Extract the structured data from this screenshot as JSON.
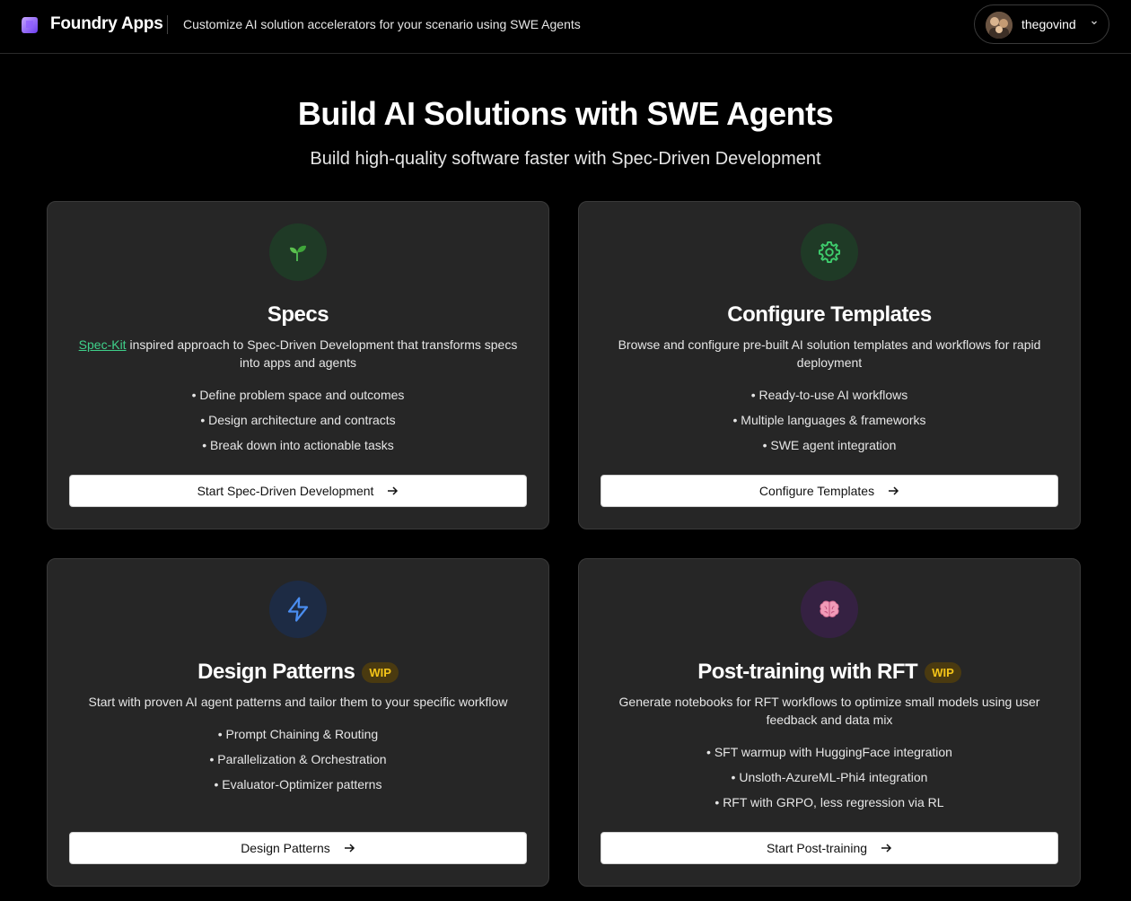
{
  "header": {
    "app_title": "Foundry Apps",
    "tagline": "Customize AI solution accelerators for your scenario using SWE Agents",
    "username": "thegovind",
    "logo_icon": "foundry-logo-icon",
    "chevron_icon": "chevron-down-icon"
  },
  "hero": {
    "title": "Build AI Solutions with SWE Agents",
    "subtitle": "Build high-quality software faster with Spec-Driven Development"
  },
  "cards": [
    {
      "icon": "seedling-icon",
      "title": "Specs",
      "link_text": "Spec-Kit",
      "description": " inspired approach to Spec-Driven Development that transforms specs into apps and agents",
      "bullets": [
        "• Define problem space and outcomes",
        "• Design architecture and contracts",
        "• Break down into actionable tasks"
      ],
      "button": "Start Spec-Driven Development"
    },
    {
      "icon": "gear-icon",
      "title": "Configure Templates",
      "description": "Browse and configure pre-built AI solution templates and workflows for rapid deployment",
      "bullets": [
        "• Ready-to-use AI workflows",
        "• Multiple languages & frameworks",
        "• SWE agent integration"
      ],
      "button": "Configure Templates"
    },
    {
      "icon": "lightning-icon",
      "title": "Design Patterns",
      "badge": "WIP",
      "description": "Start with proven AI agent patterns and tailor them to your specific workflow",
      "bullets": [
        "• Prompt Chaining & Routing",
        "• Parallelization & Orchestration",
        "• Evaluator-Optimizer patterns"
      ],
      "button": "Design Patterns"
    },
    {
      "icon": "brain-icon",
      "title": "Post-training with RFT",
      "badge": "WIP",
      "description": "Generate notebooks for RFT workflows to optimize small models using user feedback and data mix",
      "bullets": [
        "• SFT warmup with HuggingFace integration",
        "• Unsloth-AzureML-Phi4 integration",
        "• RFT with GRPO, less regression via RL"
      ],
      "button": "Start Post-training"
    }
  ],
  "colors": {
    "background": "#000000",
    "card": "#262626",
    "accent_link": "#3fd08a",
    "wip_badge": "#f5c518",
    "gear_green": "#3fcf6e",
    "lightning_blue": "#4a8df0"
  }
}
